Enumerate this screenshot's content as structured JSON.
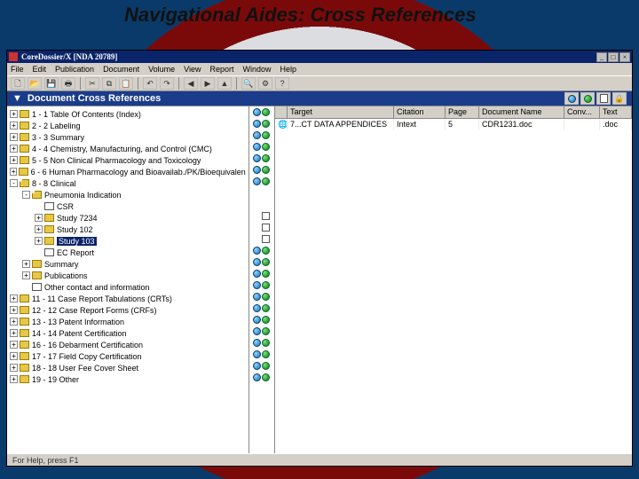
{
  "slide_title": "Navigational Aides:  Cross References",
  "app": {
    "title": "CoreDossier/X   [NDA 20789]",
    "menus": [
      "File",
      "Edit",
      "Publication",
      "Document",
      "Volume",
      "View",
      "Report",
      "Window",
      "Help"
    ],
    "section_header": "Document Cross References",
    "statusbar": "For Help, press F1"
  },
  "tree": [
    {
      "level": 0,
      "twisty": "+",
      "icon": "folder",
      "label": "1 - 1 Table Of Contents (Index)"
    },
    {
      "level": 0,
      "twisty": "+",
      "icon": "folder",
      "label": "2 - 2 Labeling"
    },
    {
      "level": 0,
      "twisty": "+",
      "icon": "folder",
      "label": "3 - 3 Summary"
    },
    {
      "level": 0,
      "twisty": "+",
      "icon": "folder",
      "label": "4 - 4 Chemistry, Manufacturing, and Control (CMC)"
    },
    {
      "level": 0,
      "twisty": "+",
      "icon": "folder",
      "label": "5 - 5 Non Clinical Pharmacology and Toxicology"
    },
    {
      "level": 0,
      "twisty": "+",
      "icon": "folder",
      "label": "6 - 6 Human Pharmacology and Bioavailab./PK/Bioequivalen"
    },
    {
      "level": 0,
      "twisty": "-",
      "icon": "folder-open",
      "label": "8 - 8 Clinical"
    },
    {
      "level": 1,
      "twisty": "-",
      "icon": "folder-open",
      "label": "Pneumonia Indication"
    },
    {
      "level": 2,
      "twisty": "",
      "icon": "page",
      "label": "CSR"
    },
    {
      "level": 2,
      "twisty": "+",
      "icon": "folder",
      "label": "Study 7234"
    },
    {
      "level": 2,
      "twisty": "+",
      "icon": "folder",
      "label": "Study 102"
    },
    {
      "level": 2,
      "twisty": "+",
      "icon": "folder",
      "label": "Study 103",
      "selected": true
    },
    {
      "level": 2,
      "twisty": "",
      "icon": "page",
      "label": "EC Report"
    },
    {
      "level": 1,
      "twisty": "+",
      "icon": "folder",
      "label": "Summary"
    },
    {
      "level": 1,
      "twisty": "+",
      "icon": "folder",
      "label": "Publications"
    },
    {
      "level": 1,
      "twisty": "",
      "icon": "page",
      "label": "Other contact and information"
    },
    {
      "level": 0,
      "twisty": "+",
      "icon": "folder",
      "label": "11 - 11 Case Report Tabulations (CRTs)"
    },
    {
      "level": 0,
      "twisty": "+",
      "icon": "folder",
      "label": "12 - 12 Case Report Forms (CRFs)"
    },
    {
      "level": 0,
      "twisty": "+",
      "icon": "folder",
      "label": "13 - 13 Patent Information"
    },
    {
      "level": 0,
      "twisty": "+",
      "icon": "folder",
      "label": "14 - 14 Patent Certification"
    },
    {
      "level": 0,
      "twisty": "+",
      "icon": "folder",
      "label": "16 - 16 Debarment Certification"
    },
    {
      "level": 0,
      "twisty": "+",
      "icon": "folder",
      "label": "17 - 17 Field Copy Certification"
    },
    {
      "level": 0,
      "twisty": "+",
      "icon": "folder",
      "label": "18 - 18 User Fee Cover Sheet"
    },
    {
      "level": 0,
      "twisty": "+",
      "icon": "folder",
      "label": "19 - 19 Other"
    }
  ],
  "icon_col_pattern": [
    "gg",
    "gg",
    "gg",
    "gg",
    "gg",
    "gg",
    "gg",
    "",
    "b",
    "bp",
    "bp",
    "bp",
    "gg",
    "gg",
    "gg",
    "gg",
    "gg",
    "gg",
    "gg",
    "gg",
    "gg",
    "gg",
    "gg",
    "gg"
  ],
  "grid": {
    "columns": [
      "",
      "Target",
      "Citation",
      "Page",
      "Document Name",
      "Conv...",
      "Text"
    ],
    "rows": [
      {
        "icon": "🌐",
        "target": "7...CT DATA APPENDICES",
        "citation": "Intext",
        "page": "5",
        "doc": "CDR1231.doc",
        "conv": "",
        "text": ".doc"
      }
    ]
  },
  "toolbar_icons": [
    "new",
    "open",
    "save",
    "print",
    "|",
    "cut",
    "copy",
    "paste",
    "|",
    "undo",
    "redo",
    "|",
    "back",
    "fwd",
    "up",
    "|",
    "find",
    "props",
    "help"
  ],
  "right_toolbar": [
    "globe",
    "green",
    "page",
    "lock"
  ]
}
